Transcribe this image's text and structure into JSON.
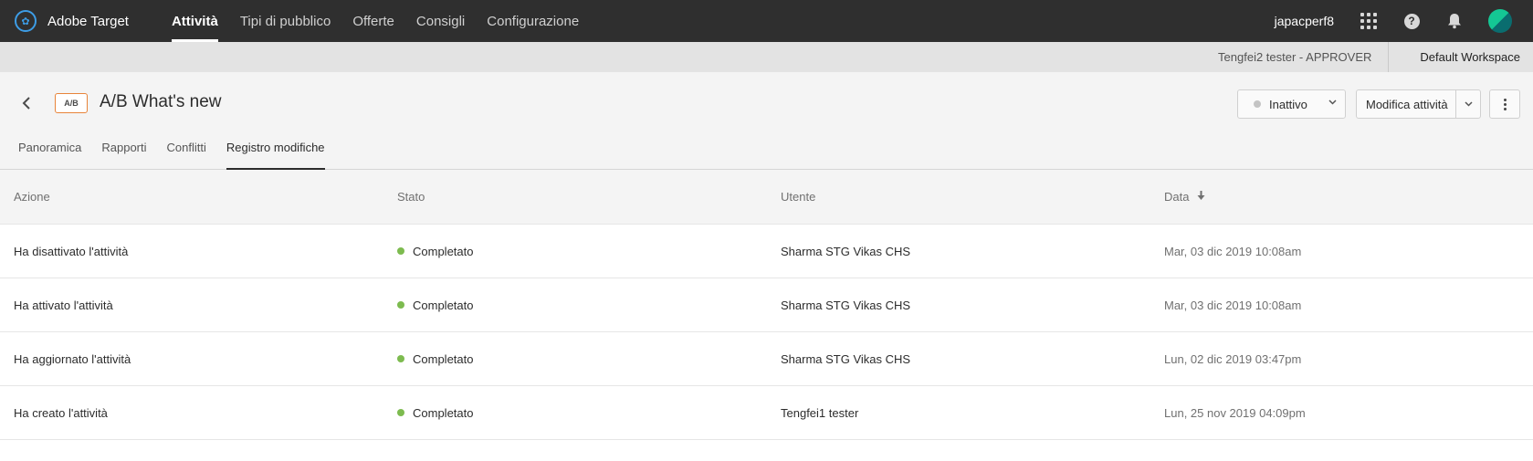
{
  "app": {
    "name": "Adobe Target"
  },
  "nav": {
    "items": [
      {
        "label": "Attività",
        "active": true
      },
      {
        "label": "Tipi di pubblico",
        "active": false
      },
      {
        "label": "Offerte",
        "active": false
      },
      {
        "label": "Consigli",
        "active": false
      },
      {
        "label": "Configurazione",
        "active": false
      }
    ]
  },
  "topbar": {
    "username": "japacperf8",
    "icons": [
      "apps-grid-icon",
      "help-icon",
      "bell-icon",
      "avatar"
    ]
  },
  "workspace": {
    "role": "Tengfei2 tester - APPROVER",
    "name": "Default Workspace"
  },
  "activity": {
    "badge": "A/B",
    "title": "A/B What's new",
    "status": "Inattivo",
    "edit_label": "Modifica attività"
  },
  "tabs": [
    {
      "label": "Panoramica",
      "active": false
    },
    {
      "label": "Rapporti",
      "active": false
    },
    {
      "label": "Conflitti",
      "active": false
    },
    {
      "label": "Registro modifiche",
      "active": true
    }
  ],
  "table": {
    "headers": {
      "action": "Azione",
      "status": "Stato",
      "user": "Utente",
      "date": "Data"
    },
    "sort": {
      "column": "date",
      "direction": "descending"
    },
    "rows": [
      {
        "action": "Ha disattivato l'attività",
        "status": "Completato",
        "user": "Sharma STG Vikas CHS",
        "date": "Mar, 03 dic 2019 10:08am"
      },
      {
        "action": "Ha attivato l'attività",
        "status": "Completato",
        "user": "Sharma STG Vikas CHS",
        "date": "Mar, 03 dic 2019 10:08am"
      },
      {
        "action": "Ha aggiornato l'attività",
        "status": "Completato",
        "user": "Sharma STG Vikas CHS",
        "date": "Lun, 02 dic 2019 03:47pm"
      },
      {
        "action": "Ha creato l'attività",
        "status": "Completato",
        "user": "Tengfei1 tester",
        "date": "Lun, 25 nov 2019 04:09pm"
      }
    ]
  },
  "colors": {
    "topbar_bg": "#2f2f2f",
    "logo_blue": "#3d9de6",
    "badge_orange": "#e8843a",
    "status_complete_green": "#7dbb4f",
    "status_inactive_gray": "#c4c4c4"
  }
}
